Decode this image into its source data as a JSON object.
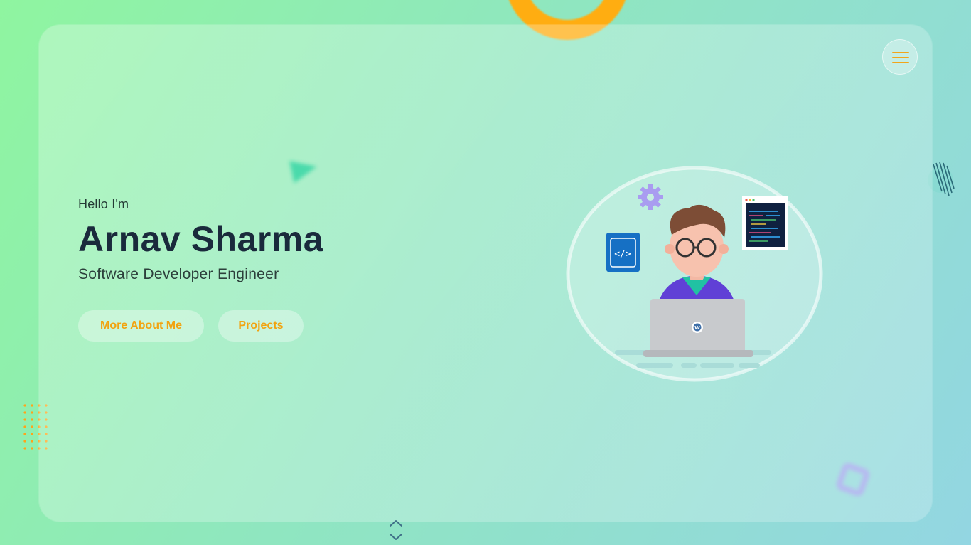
{
  "hero": {
    "greeting": "Hello I'm",
    "name": "Arnav Sharma",
    "role": "Software Developer Engineer"
  },
  "actions": {
    "about_label": "More About Me",
    "projects_label": "Projects"
  },
  "icons": {
    "menu": "hamburger-menu-icon",
    "scroll": "scroll-chevron-icon",
    "illustration": "developer-illustration"
  },
  "colors": {
    "accent": "#f2a30f",
    "heading": "#1a2a3c",
    "background_start": "#8ff5a0",
    "background_end": "#93d6e2"
  }
}
